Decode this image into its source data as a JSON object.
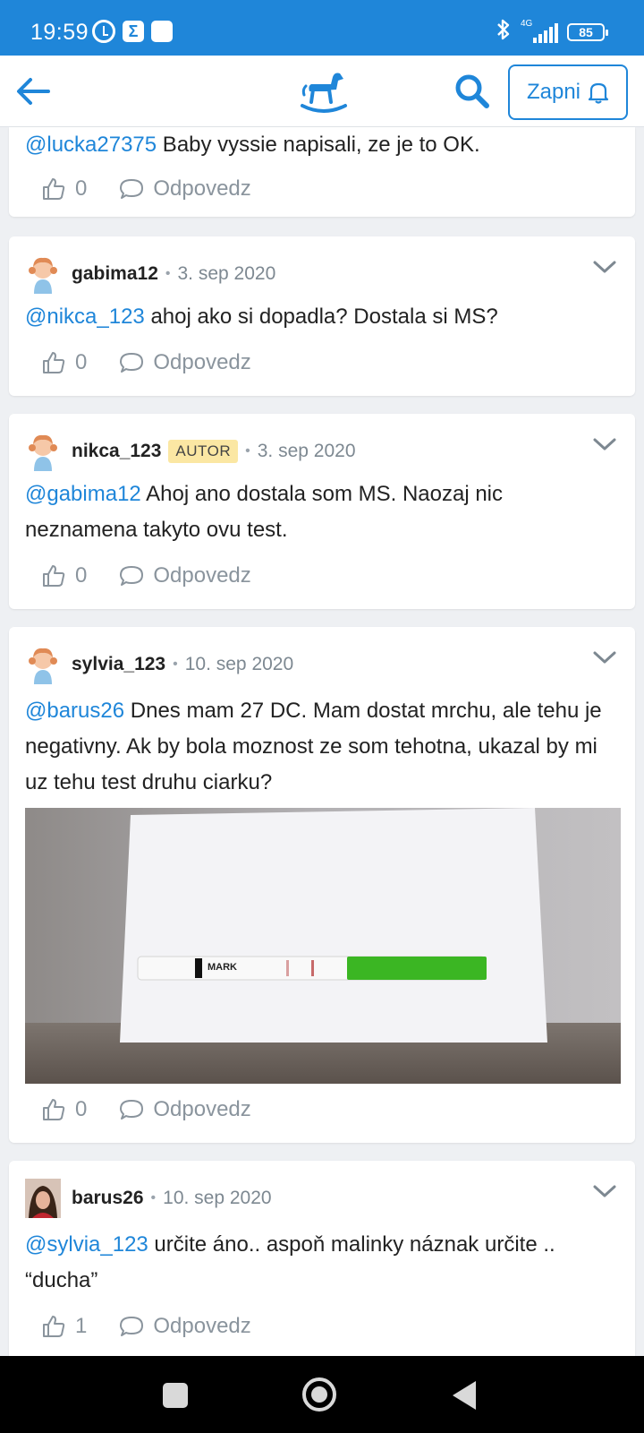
{
  "status_bar": {
    "time": "19:59",
    "network": "4G",
    "battery": "85"
  },
  "app_bar": {
    "zapni_label": "Zapni"
  },
  "actions": {
    "reply_label": "Odpovedz"
  },
  "cards": [
    {
      "mention": "@lucka27375",
      "text": " Baby vyssie napisali, ze je to OK.",
      "likes": "0"
    },
    {
      "username": "gabima12",
      "date": "3. sep 2020",
      "mention": "@nikca_123",
      "text": " ahoj ako si dopadla? Dostala si MS?",
      "likes": "0"
    },
    {
      "username": "nikca_123",
      "badge": "AUTOR",
      "date": "3. sep 2020",
      "mention": "@gabima12",
      "text": " Ahoj ano dostala som MS. Naozaj nic neznamena takyto ovu test.",
      "likes": "0"
    },
    {
      "username": "sylvia_123",
      "date": "10. sep 2020",
      "mention": "@barus26",
      "text": " Dnes mam 27 DC. Mam dostat mrchu, ale tehu je negativny. Ak by bola moznost ze som tehotna, ukazal by mi uz tehu test druhu ciarku?",
      "photo_label": "MARK",
      "likes": "0"
    },
    {
      "username": "barus26",
      "date": "10. sep 2020",
      "mention": "@sylvia_123",
      "text": " určite áno.. aspoň malinky náznak určite .. “ducha”",
      "likes": "1"
    }
  ],
  "colors": {
    "accent": "#1f86d9",
    "badge_bg": "#fbe7a3",
    "muted": "#8a949d"
  }
}
